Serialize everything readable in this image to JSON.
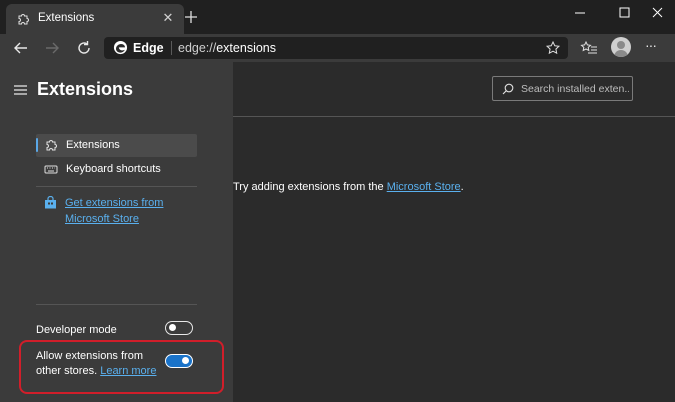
{
  "tab": {
    "title": "Extensions",
    "close_glyph": "✕"
  },
  "toolbar": {
    "brand": "Edge",
    "url_scheme": "edge://",
    "url_host": "extensions",
    "more_glyph": "···"
  },
  "sidebar": {
    "title": "Extensions",
    "nav": [
      {
        "label": "Extensions",
        "selected": true
      },
      {
        "label": "Keyboard shortcuts",
        "selected": false
      }
    ],
    "store_link": "Get extensions from Microsoft Store",
    "developer_mode": {
      "label": "Developer mode",
      "enabled": false
    },
    "allow_other_stores": {
      "label": "Allow extensions from other stores.",
      "link": "Learn more",
      "enabled": true
    }
  },
  "main": {
    "search_placeholder": "Search installed exten...",
    "empty_prefix": "Try adding extensions from the",
    "empty_link": "Microsoft Store",
    "empty_suffix": "."
  },
  "colors": {
    "accent_link": "#5ab0ee",
    "highlight_border": "#d11e2a",
    "toggle_on": "#1a73c9",
    "edge_blue": "#2f86d6"
  }
}
